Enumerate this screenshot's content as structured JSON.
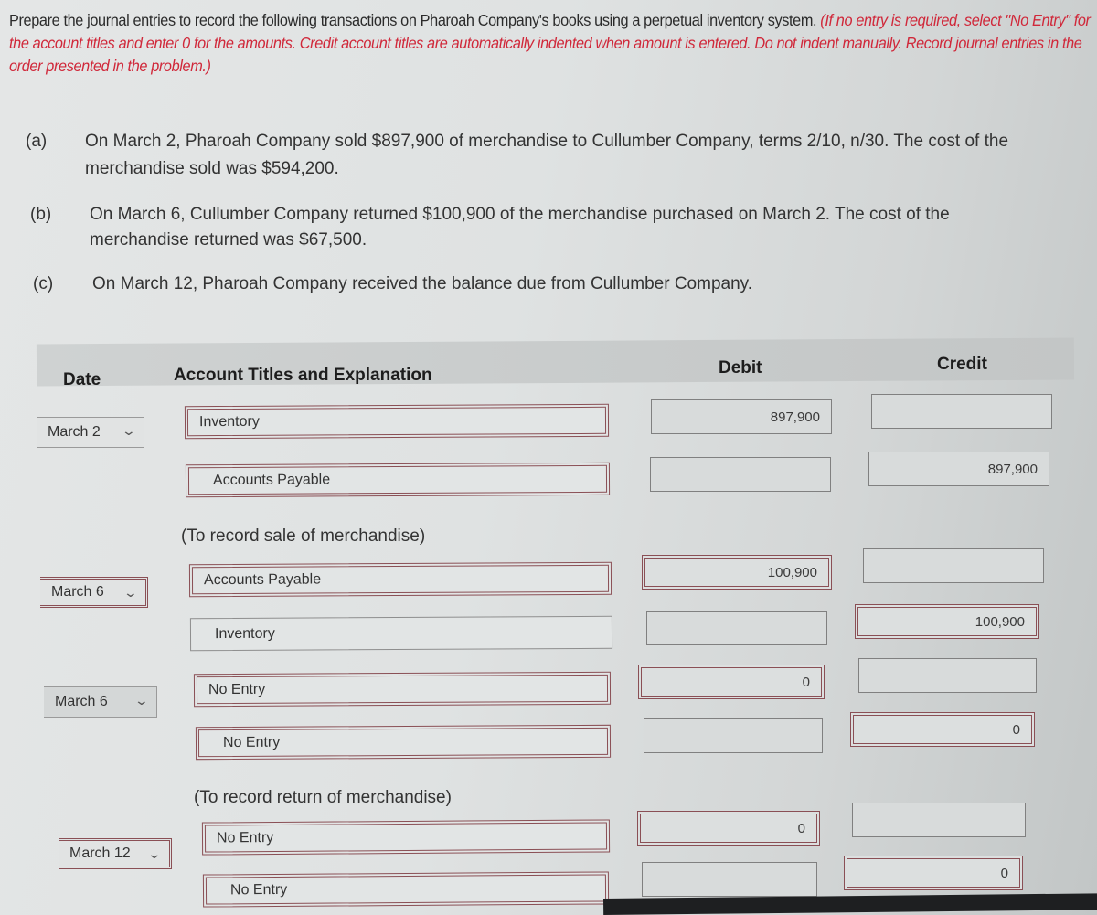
{
  "instructions": {
    "main": "Prepare the journal entries to record the following transactions on Pharoah Company's books using a perpetual inventory system.",
    "note": "(If no entry is required, select \"No Entry\" for the account titles and enter 0 for the amounts. Credit account titles are automatically indented when amount is entered. Do not indent manually. Record journal entries in the order presented in the problem.)"
  },
  "transactions": [
    {
      "letter": "(a)",
      "line1": "On March 2, Pharoah Company sold $897,900 of merchandise to Cullumber Company, terms 2/10, n/30. The cost of the",
      "line2": "merchandise sold was $594,200."
    },
    {
      "letter": "(b)",
      "line1": "On March 6, Cullumber Company returned $100,900 of the merchandise purchased on March 2. The cost of the",
      "line2": "merchandise returned was $67,500."
    },
    {
      "letter": "(c)",
      "line1": "On March 12, Pharoah Company received the balance due from Cullumber Company.",
      "line2": ""
    }
  ],
  "table": {
    "headers": {
      "date": "Date",
      "account": "Account Titles and Explanation",
      "debit": "Debit",
      "credit": "Credit"
    },
    "entries": [
      {
        "date": "March 2",
        "lines": [
          {
            "account": "Inventory",
            "debit": "897,900",
            "credit": ""
          },
          {
            "account": "Accounts Payable",
            "debit": "",
            "credit": "897,900"
          }
        ],
        "explanation": "(To record sale of merchandise)"
      },
      {
        "date": "March 6",
        "lines": [
          {
            "account": "Accounts Payable",
            "debit": "100,900",
            "credit": ""
          },
          {
            "account": "Inventory",
            "debit": "",
            "credit": "100,900"
          }
        ],
        "explanation": ""
      },
      {
        "date": "March 6",
        "lines": [
          {
            "account": "No Entry",
            "debit": "0",
            "credit": ""
          },
          {
            "account": "No Entry",
            "debit": "",
            "credit": "0"
          }
        ],
        "explanation": "(To record return of merchandise)"
      },
      {
        "date": "March 12",
        "lines": [
          {
            "account": "No Entry",
            "debit": "0",
            "credit": ""
          },
          {
            "account": "No Entry",
            "debit": "",
            "credit": "0"
          }
        ],
        "explanation": ""
      }
    ]
  },
  "icons": {
    "date_dropdown": "chevron-down-icon"
  },
  "colors": {
    "instruction_red": "#d0283a",
    "error_border": "#8a4f55",
    "header_bg": "#cfd2d2"
  }
}
